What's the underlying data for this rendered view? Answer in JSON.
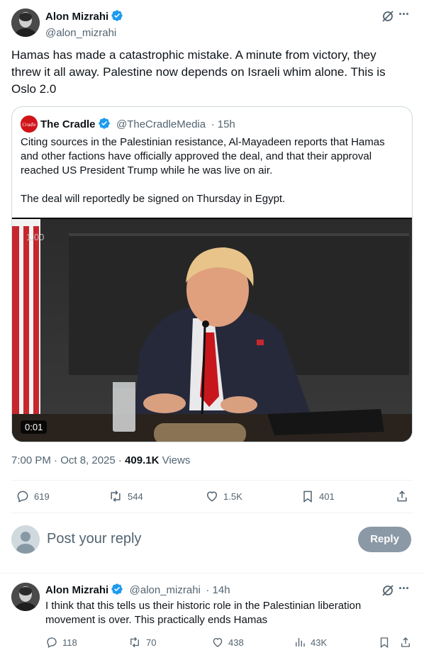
{
  "post": {
    "author_name": "Alon Mizrahi",
    "author_handle": "@alon_mizrahi",
    "text": "Hamas has made a catastrophic mistake. A minute from victory, they threw it all away. Palestine now depends on Israeli whim alone. This is Oslo 2.0",
    "more_label": "···"
  },
  "quote": {
    "logo_text": "Cradle",
    "author_name": "The Cradle",
    "author_handle": "@TheCradleMedia",
    "time": "· 15h",
    "paragraph1": "Citing sources in the Palestinian resistance, Al-Mayadeen reports that Hamas and other factions have officially approved the deal, and that their approval reached US President Trump while he was live on air.",
    "paragraph2": "The deal will reportedly be signed on Thursday in Egypt.",
    "video_speed": "1.00",
    "video_time": "0:01"
  },
  "meta": {
    "time": "7:00 PM · Oct 8, 2025 · ",
    "views_count": "409.1K",
    "views_label": " Views"
  },
  "actions": {
    "replies": "619",
    "reposts": "544",
    "likes": "1.5K",
    "bookmarks": "401"
  },
  "composer": {
    "placeholder": "Post your reply",
    "button": "Reply"
  },
  "reply": {
    "author_name": "Alon Mizrahi",
    "author_handle": "@alon_mizrahi",
    "time": "· 14h",
    "text": "I think that this tells us their historic role in the Palestinian liberation movement is over. This practically ends Hamas",
    "replies": "118",
    "reposts": "70",
    "likes": "438",
    "views": "43K"
  },
  "colors": {
    "accent": "#1d9bf0",
    "muted": "#536471",
    "reply_button": "#8b98a5"
  }
}
